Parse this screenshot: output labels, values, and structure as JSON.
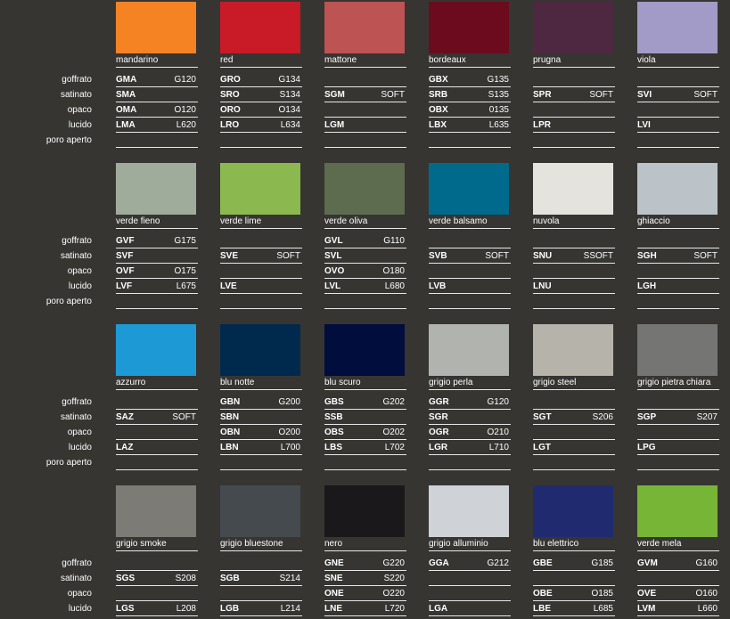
{
  "row_labels": [
    "goffrato",
    "satinato",
    "opaco",
    "lucido",
    "poro aperto"
  ],
  "groups": [
    {
      "colors": [
        {
          "name": "mandarino",
          "hex": "#f58223",
          "codes": [
            [
              "GMA",
              "G120"
            ],
            [
              "SMA",
              ""
            ],
            [
              "OMA",
              "O120"
            ],
            [
              "LMA",
              "L620"
            ],
            [
              "",
              ""
            ]
          ]
        },
        {
          "name": "red",
          "hex": "#c91a27",
          "codes": [
            [
              "GRO",
              "G134"
            ],
            [
              "SRO",
              "S134"
            ],
            [
              "ORO",
              "O134"
            ],
            [
              "LRO",
              "L634"
            ],
            [
              "",
              ""
            ]
          ]
        },
        {
          "name": "mattone",
          "hex": "#bd5352",
          "codes": [
            [
              "",
              ""
            ],
            [
              "SGM",
              "SOFT"
            ],
            [
              "",
              ""
            ],
            [
              "LGM",
              ""
            ],
            [
              "",
              ""
            ]
          ]
        },
        {
          "name": "bordeaux",
          "hex": "#6c0b1d",
          "codes": [
            [
              "GBX",
              "G135"
            ],
            [
              "SRB",
              "S135"
            ],
            [
              "OBX",
              "0135"
            ],
            [
              "LBX",
              "L635"
            ],
            [
              "",
              ""
            ]
          ]
        },
        {
          "name": "prugna",
          "hex": "#4e2840",
          "codes": [
            [
              "",
              ""
            ],
            [
              "SPR",
              "SOFT"
            ],
            [
              "",
              ""
            ],
            [
              "LPR",
              ""
            ],
            [
              "",
              ""
            ]
          ]
        },
        {
          "name": "viola",
          "hex": "#a29bc7",
          "codes": [
            [
              "",
              ""
            ],
            [
              "SVI",
              "SOFT"
            ],
            [
              "",
              ""
            ],
            [
              "LVI",
              ""
            ],
            [
              "",
              ""
            ]
          ]
        }
      ]
    },
    {
      "colors": [
        {
          "name": "verde fieno",
          "hex": "#a0ac9b",
          "codes": [
            [
              "GVF",
              "G175"
            ],
            [
              "SVF",
              ""
            ],
            [
              "OVF",
              "O175"
            ],
            [
              "LVF",
              "L675"
            ],
            [
              "",
              ""
            ]
          ]
        },
        {
          "name": "verde lime",
          "hex": "#8cb94f",
          "codes": [
            [
              "",
              ""
            ],
            [
              "SVE",
              "SOFT"
            ],
            [
              "",
              ""
            ],
            [
              "LVE",
              ""
            ],
            [
              "",
              ""
            ]
          ]
        },
        {
          "name": "verde oliva",
          "hex": "#5d6b4e",
          "codes": [
            [
              "GVL",
              "G110"
            ],
            [
              "SVL",
              ""
            ],
            [
              "OVO",
              "O180"
            ],
            [
              "LVL",
              "L680"
            ],
            [
              "",
              ""
            ]
          ]
        },
        {
          "name": "verde balsamo",
          "hex": "#006a8c",
          "codes": [
            [
              "",
              ""
            ],
            [
              "SVB",
              "SOFT"
            ],
            [
              "",
              ""
            ],
            [
              "LVB",
              ""
            ],
            [
              "",
              ""
            ]
          ]
        },
        {
          "name": "nuvola",
          "hex": "#e4e3de",
          "codes": [
            [
              "",
              ""
            ],
            [
              "SNU",
              "SSOFT"
            ],
            [
              "",
              ""
            ],
            [
              "LNU",
              ""
            ],
            [
              "",
              ""
            ]
          ]
        },
        {
          "name": "ghiaccio",
          "hex": "#bcc3c8",
          "codes": [
            [
              "",
              ""
            ],
            [
              "SGH",
              "SOFT"
            ],
            [
              "",
              ""
            ],
            [
              "LGH",
              ""
            ],
            [
              "",
              ""
            ]
          ]
        }
      ]
    },
    {
      "colors": [
        {
          "name": "azzurro",
          "hex": "#1d9ad6",
          "codes": [
            [
              "",
              ""
            ],
            [
              "SAZ",
              "SOFT"
            ],
            [
              "",
              ""
            ],
            [
              "LAZ",
              ""
            ],
            [
              "",
              ""
            ]
          ]
        },
        {
          "name": "blu notte",
          "hex": "#002a4d",
          "codes": [
            [
              "GBN",
              "G200"
            ],
            [
              "SBN",
              ""
            ],
            [
              "OBN",
              "O200"
            ],
            [
              "LBN",
              "L700"
            ],
            [
              "",
              ""
            ]
          ]
        },
        {
          "name": "blu scuro",
          "hex": "#000d3d",
          "codes": [
            [
              "GBS",
              "G202"
            ],
            [
              "SSB",
              ""
            ],
            [
              "OBS",
              "O202"
            ],
            [
              "LBS",
              "L702"
            ],
            [
              "",
              ""
            ]
          ]
        },
        {
          "name": "grigio perla",
          "hex": "#b1b4ae",
          "codes": [
            [
              "GGR",
              "G120"
            ],
            [
              "SGR",
              ""
            ],
            [
              "OGR",
              "O210"
            ],
            [
              "LGR",
              "L710"
            ],
            [
              "",
              ""
            ]
          ]
        },
        {
          "name": "grigio steel",
          "hex": "#b6b3aa",
          "codes": [
            [
              "",
              ""
            ],
            [
              "SGT",
              "S206"
            ],
            [
              "",
              ""
            ],
            [
              "LGT",
              ""
            ],
            [
              "",
              ""
            ]
          ]
        },
        {
          "name": "grigio pietra chiara",
          "hex": "#757673",
          "codes": [
            [
              "",
              ""
            ],
            [
              "SGP",
              "S207"
            ],
            [
              "",
              ""
            ],
            [
              "LPG",
              ""
            ],
            [
              "",
              ""
            ]
          ]
        }
      ]
    },
    {
      "colors": [
        {
          "name": "grigio smoke",
          "hex": "#7c7b76",
          "codes": [
            [
              "",
              ""
            ],
            [
              "SGS",
              "S208"
            ],
            [
              "",
              ""
            ],
            [
              "LGS",
              "L208"
            ]
          ]
        },
        {
          "name": "grigio bluestone",
          "hex": "#454a4e",
          "codes": [
            [
              "",
              ""
            ],
            [
              "SGB",
              "S214"
            ],
            [
              "",
              ""
            ],
            [
              "LGB",
              "L214"
            ]
          ]
        },
        {
          "name": "nero",
          "hex": "#1a181a",
          "codes": [
            [
              "GNE",
              "G220"
            ],
            [
              "SNE",
              "S220"
            ],
            [
              "ONE",
              "O220"
            ],
            [
              "LNE",
              "L720"
            ]
          ]
        },
        {
          "name": "grigio alluminio",
          "hex": "#cfd2d7",
          "codes": [
            [
              "GGA",
              "G212"
            ],
            [
              "",
              ""
            ],
            [
              "",
              ""
            ],
            [
              "LGA",
              ""
            ]
          ]
        },
        {
          "name": "blu elettrico",
          "hex": "#202b6f",
          "codes": [
            [
              "GBE",
              "G185"
            ],
            [
              "",
              ""
            ],
            [
              "OBE",
              "O185"
            ],
            [
              "LBE",
              "L685"
            ]
          ]
        },
        {
          "name": "verde mela",
          "hex": "#77b536",
          "codes": [
            [
              "GVM",
              "G160"
            ],
            [
              "",
              ""
            ],
            [
              "OVE",
              "O160"
            ],
            [
              "LVM",
              "L660"
            ]
          ]
        }
      ]
    }
  ]
}
